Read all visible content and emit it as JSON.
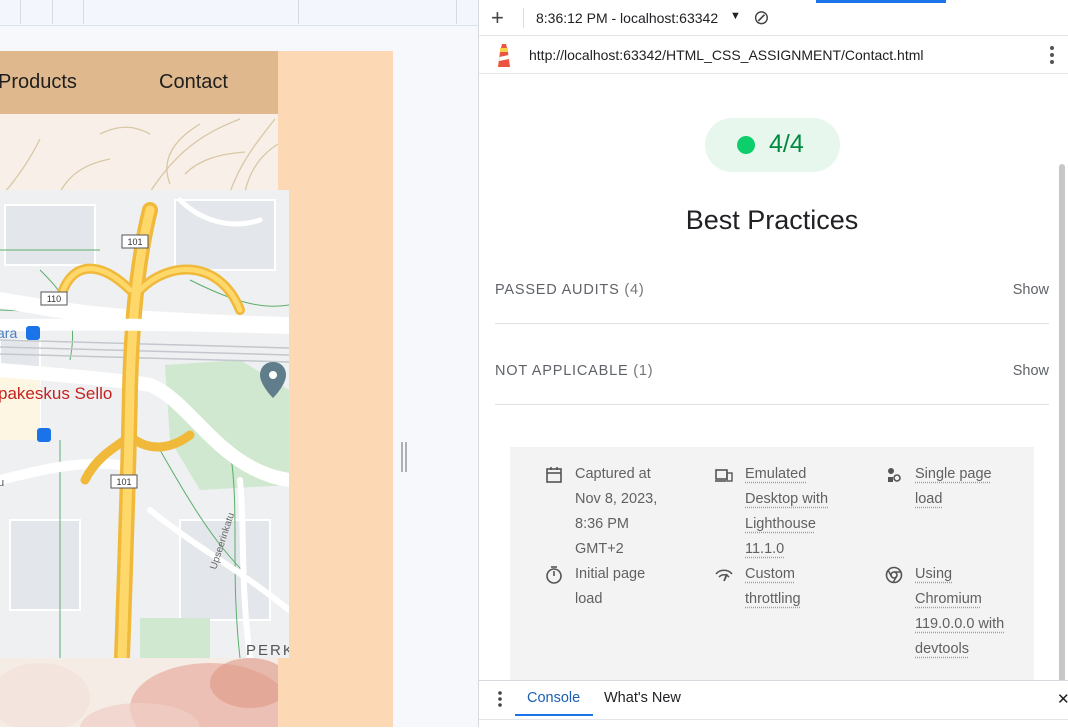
{
  "site": {
    "nav": {
      "products": "Products",
      "contact": "Contact"
    },
    "map": {
      "labels": {
        "shopping_center": "pakeskus Sello",
        "station": "ara",
        "district": "PERK",
        "street": "Upseerinkatu",
        "road_edge": "u"
      },
      "road_shields": [
        "101",
        "110",
        "101"
      ]
    }
  },
  "devtools": {
    "toolbar": {
      "new_tab": "+",
      "report_selector": "8:36:12 PM - localhost:63342",
      "dropdown_icon": "▼",
      "clear_icon": "⊘"
    },
    "url": "http://localhost:63342/HTML_CSS_ASSIGNMENT/Contact.html",
    "report": {
      "score": "4/4",
      "category_title": "Best Practices",
      "audits": [
        {
          "label": "PASSED AUDITS",
          "count": "(4)",
          "action": "Show"
        },
        {
          "label": "NOT APPLICABLE",
          "count": "(1)",
          "action": "Show"
        }
      ],
      "environment": {
        "captured": {
          "lines": [
            "Captured at",
            "Nov 8, 2023,",
            "8:36 PM",
            "GMT+2"
          ]
        },
        "emulated": {
          "lines": [
            "Emulated",
            "Desktop with",
            "Lighthouse",
            "11.1.0"
          ]
        },
        "single_page": {
          "lines": [
            "Single page",
            "load"
          ]
        },
        "initial_load": {
          "lines": [
            "Initial page",
            "load"
          ]
        },
        "throttling": {
          "lines": [
            "Custom",
            "throttling"
          ]
        },
        "chromium": {
          "lines": [
            "Using",
            "Chromium",
            "119.0.0.0 with",
            "devtools"
          ]
        }
      }
    },
    "drawer": {
      "tabs": [
        "Console",
        "What's New"
      ],
      "close": "✕"
    }
  },
  "colors": {
    "score_green": "#0cce6b",
    "nav_tan": "#dfb98d",
    "site_peach": "#fdd8b4",
    "accent_blue": "#1a73e8"
  }
}
